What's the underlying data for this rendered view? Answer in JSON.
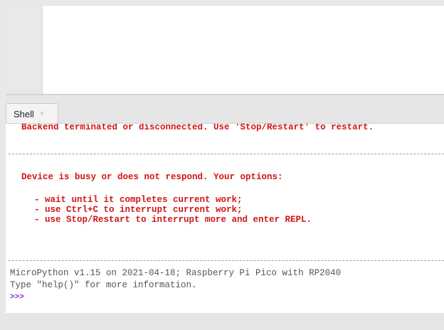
{
  "shell_tab": {
    "label": "Shell",
    "close": "×"
  },
  "shell": {
    "lines": [
      "Backend terminated or disconnected. Use 'Stop/Restart' to restart.",
      "Device is busy or does not respond. Your options:",
      "- wait until it completes current work;",
      "- use Ctrl+C to interrupt current work;",
      "- use Stop/Restart to interrupt more and enter REPL."
    ],
    "info": [
      "MicroPython v1.15 on 2021-04-18; Raspberry Pi Pico with RP2040",
      "Type \"help()\" for more information."
    ],
    "prompt": ">>>"
  },
  "colors": {
    "error_text": "#d01515",
    "info_text": "#555555",
    "prompt": "#7a2bd6"
  }
}
